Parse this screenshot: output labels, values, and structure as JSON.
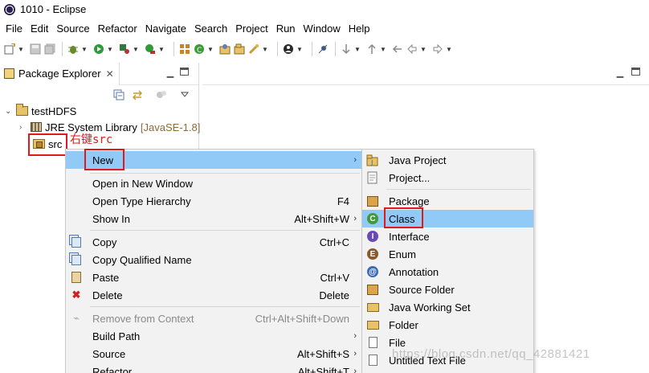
{
  "window": {
    "title": "1010 - Eclipse"
  },
  "menubar": {
    "items": [
      "File",
      "Edit",
      "Source",
      "Refactor",
      "Navigate",
      "Search",
      "Project",
      "Run",
      "Window",
      "Help"
    ]
  },
  "toolbar": {
    "icons": [
      "new-icon",
      "save-icon",
      "save-all-icon",
      "debug-icon",
      "run-icon",
      "coverage-icon",
      "external-tools-icon",
      "new-java-project-icon",
      "new-java-class-icon",
      "open-type-icon",
      "open-task-icon",
      "search-icon",
      "profile-icon",
      "toggle-breakpoint-icon",
      "next-annotation-icon",
      "previous-annotation-icon",
      "last-edit-icon",
      "back-icon",
      "forward-icon"
    ]
  },
  "package_explorer": {
    "tab_label": "Package Explorer",
    "tree": {
      "project": "testHDFS",
      "library": "JRE System Library",
      "library_suffix": "[JavaSE-1.8]",
      "source_folder": "src"
    },
    "annotation": "右键src"
  },
  "context_menu": {
    "items": [
      {
        "label": "New",
        "accel": "",
        "submenu": true,
        "icon": ""
      },
      {
        "label": "Open in New Window",
        "accel": "",
        "submenu": false,
        "icon": ""
      },
      {
        "label": "Open Type Hierarchy",
        "accel": "F4",
        "submenu": false,
        "icon": ""
      },
      {
        "label": "Show In",
        "accel": "Alt+Shift+W",
        "submenu": true,
        "icon": ""
      },
      {
        "label": "Copy",
        "accel": "Ctrl+C",
        "submenu": false,
        "icon": "copy-icon"
      },
      {
        "label": "Copy Qualified Name",
        "accel": "",
        "submenu": false,
        "icon": "copy-qualified-name-icon"
      },
      {
        "label": "Paste",
        "accel": "Ctrl+V",
        "submenu": false,
        "icon": "paste-icon"
      },
      {
        "label": "Delete",
        "accel": "Delete",
        "submenu": false,
        "icon": "delete-icon"
      },
      {
        "label": "Remove from Context",
        "accel": "Ctrl+Alt+Shift+Down",
        "submenu": false,
        "icon": "remove-context-icon",
        "disabled": true
      },
      {
        "label": "Build Path",
        "accel": "",
        "submenu": true,
        "icon": ""
      },
      {
        "label": "Source",
        "accel": "Alt+Shift+S",
        "submenu": true,
        "icon": ""
      },
      {
        "label": "Refactor",
        "accel": "Alt+Shift+T",
        "submenu": true,
        "icon": ""
      }
    ]
  },
  "new_submenu": {
    "items": [
      {
        "label": "Java Project",
        "icon": "java-project-icon"
      },
      {
        "label": "Project...",
        "icon": "project-icon"
      },
      {
        "label": "Package",
        "icon": "package-icon"
      },
      {
        "label": "Class",
        "icon": "class-icon",
        "highlighted": true
      },
      {
        "label": "Interface",
        "icon": "interface-icon"
      },
      {
        "label": "Enum",
        "icon": "enum-icon"
      },
      {
        "label": "Annotation",
        "icon": "annotation-icon"
      },
      {
        "label": "Source Folder",
        "icon": "source-folder-icon"
      },
      {
        "label": "Java Working Set",
        "icon": "java-working-set-icon"
      },
      {
        "label": "Folder",
        "icon": "folder-icon"
      },
      {
        "label": "File",
        "icon": "file-icon"
      },
      {
        "label": "Untitled Text File",
        "icon": "text-file-icon"
      }
    ]
  },
  "watermark": "https://blog.csdn.net/qq_42881421",
  "colors": {
    "highlight": "#91c9f7",
    "annotation_red": "#e01919",
    "menu_bg": "#f2f2f2"
  }
}
